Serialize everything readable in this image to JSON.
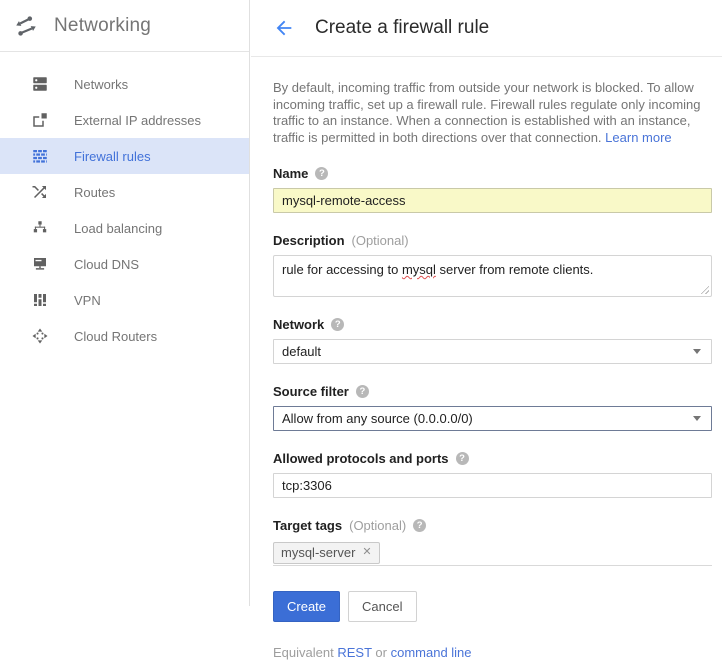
{
  "colors": {
    "accent_blue": "#3b6ed6",
    "link_blue": "#4a74d8",
    "selected_nav_bg": "#dbe4f8",
    "selected_nav_text": "#4272d9",
    "name_field_highlight": "#f9f9c8",
    "icon_gray": "#616161"
  },
  "icons": {
    "help_glyph": "?",
    "chip_close_glyph": "✕"
  },
  "sidebar": {
    "title": "Networking",
    "items": [
      {
        "label": "Networks",
        "selected": false
      },
      {
        "label": "External IP addresses",
        "selected": false
      },
      {
        "label": "Firewall rules",
        "selected": true
      },
      {
        "label": "Routes",
        "selected": false
      },
      {
        "label": "Load balancing",
        "selected": false
      },
      {
        "label": "Cloud DNS",
        "selected": false
      },
      {
        "label": "VPN",
        "selected": false
      },
      {
        "label": "Cloud Routers",
        "selected": false
      }
    ]
  },
  "header": {
    "title": "Create a firewall rule"
  },
  "intro": {
    "text": "By default, incoming traffic from outside your network is blocked. To allow incoming traffic, set up a firewall rule. Firewall rules regulate only incoming traffic to an instance. When a connection is established with an instance, traffic is permitted in both directions over that connection.",
    "link": "Learn more"
  },
  "form": {
    "name": {
      "label": "Name",
      "value": "mysql-remote-access"
    },
    "description": {
      "label": "Description",
      "optional": "(Optional)",
      "value_pre": "rule for accessing to ",
      "value_misspelled": "mysql",
      "value_post": " server from remote clients."
    },
    "network": {
      "label": "Network",
      "value": "default"
    },
    "source_filter": {
      "label": "Source filter",
      "value": "Allow from any source (0.0.0.0/0)"
    },
    "protocols": {
      "label": "Allowed protocols and ports",
      "value": "tcp:3306"
    },
    "target_tags": {
      "label": "Target tags",
      "optional": "(Optional)",
      "chip": "mysql-server"
    }
  },
  "actions": {
    "create": "Create",
    "cancel": "Cancel"
  },
  "footer": {
    "prefix": "Equivalent",
    "rest_link": "REST",
    "or": "or",
    "cli_link": "command line"
  }
}
